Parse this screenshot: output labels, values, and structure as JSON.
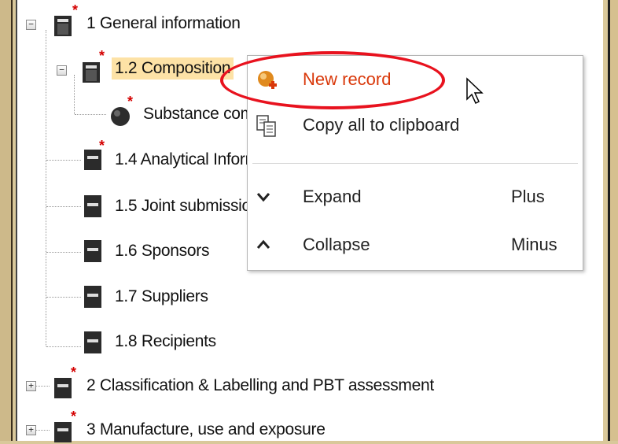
{
  "tree": {
    "items": [
      {
        "label": "1 General information"
      },
      {
        "label": "1.2 Composition"
      },
      {
        "label": "Substance composition"
      },
      {
        "label": "1.4 Analytical Information"
      },
      {
        "label": "1.5 Joint submission"
      },
      {
        "label": "1.6 Sponsors"
      },
      {
        "label": "1.7 Suppliers"
      },
      {
        "label": "1.8 Recipients"
      },
      {
        "label": "2 Classification & Labelling and PBT assessment"
      },
      {
        "label": "3 Manufacture, use and exposure"
      }
    ],
    "expanders": {
      "collapse": "−",
      "expand": "+"
    },
    "required_marker": "*"
  },
  "context_menu": {
    "items": [
      {
        "label": "New record",
        "shortcut": "",
        "color": "#d9380a",
        "icon": "new-record-icon"
      },
      {
        "label": "Copy all to clipboard",
        "shortcut": "",
        "icon": "clipboard-icon"
      },
      {
        "label": "Expand",
        "shortcut": "Plus",
        "icon": "chevron-down-icon"
      },
      {
        "label": "Collapse",
        "shortcut": "Minus",
        "icon": "chevron-up-icon"
      }
    ]
  },
  "colors": {
    "highlight_ellipse": "#e8121e",
    "selected_row": "#fde2a6",
    "required_marker": "#d40000"
  }
}
